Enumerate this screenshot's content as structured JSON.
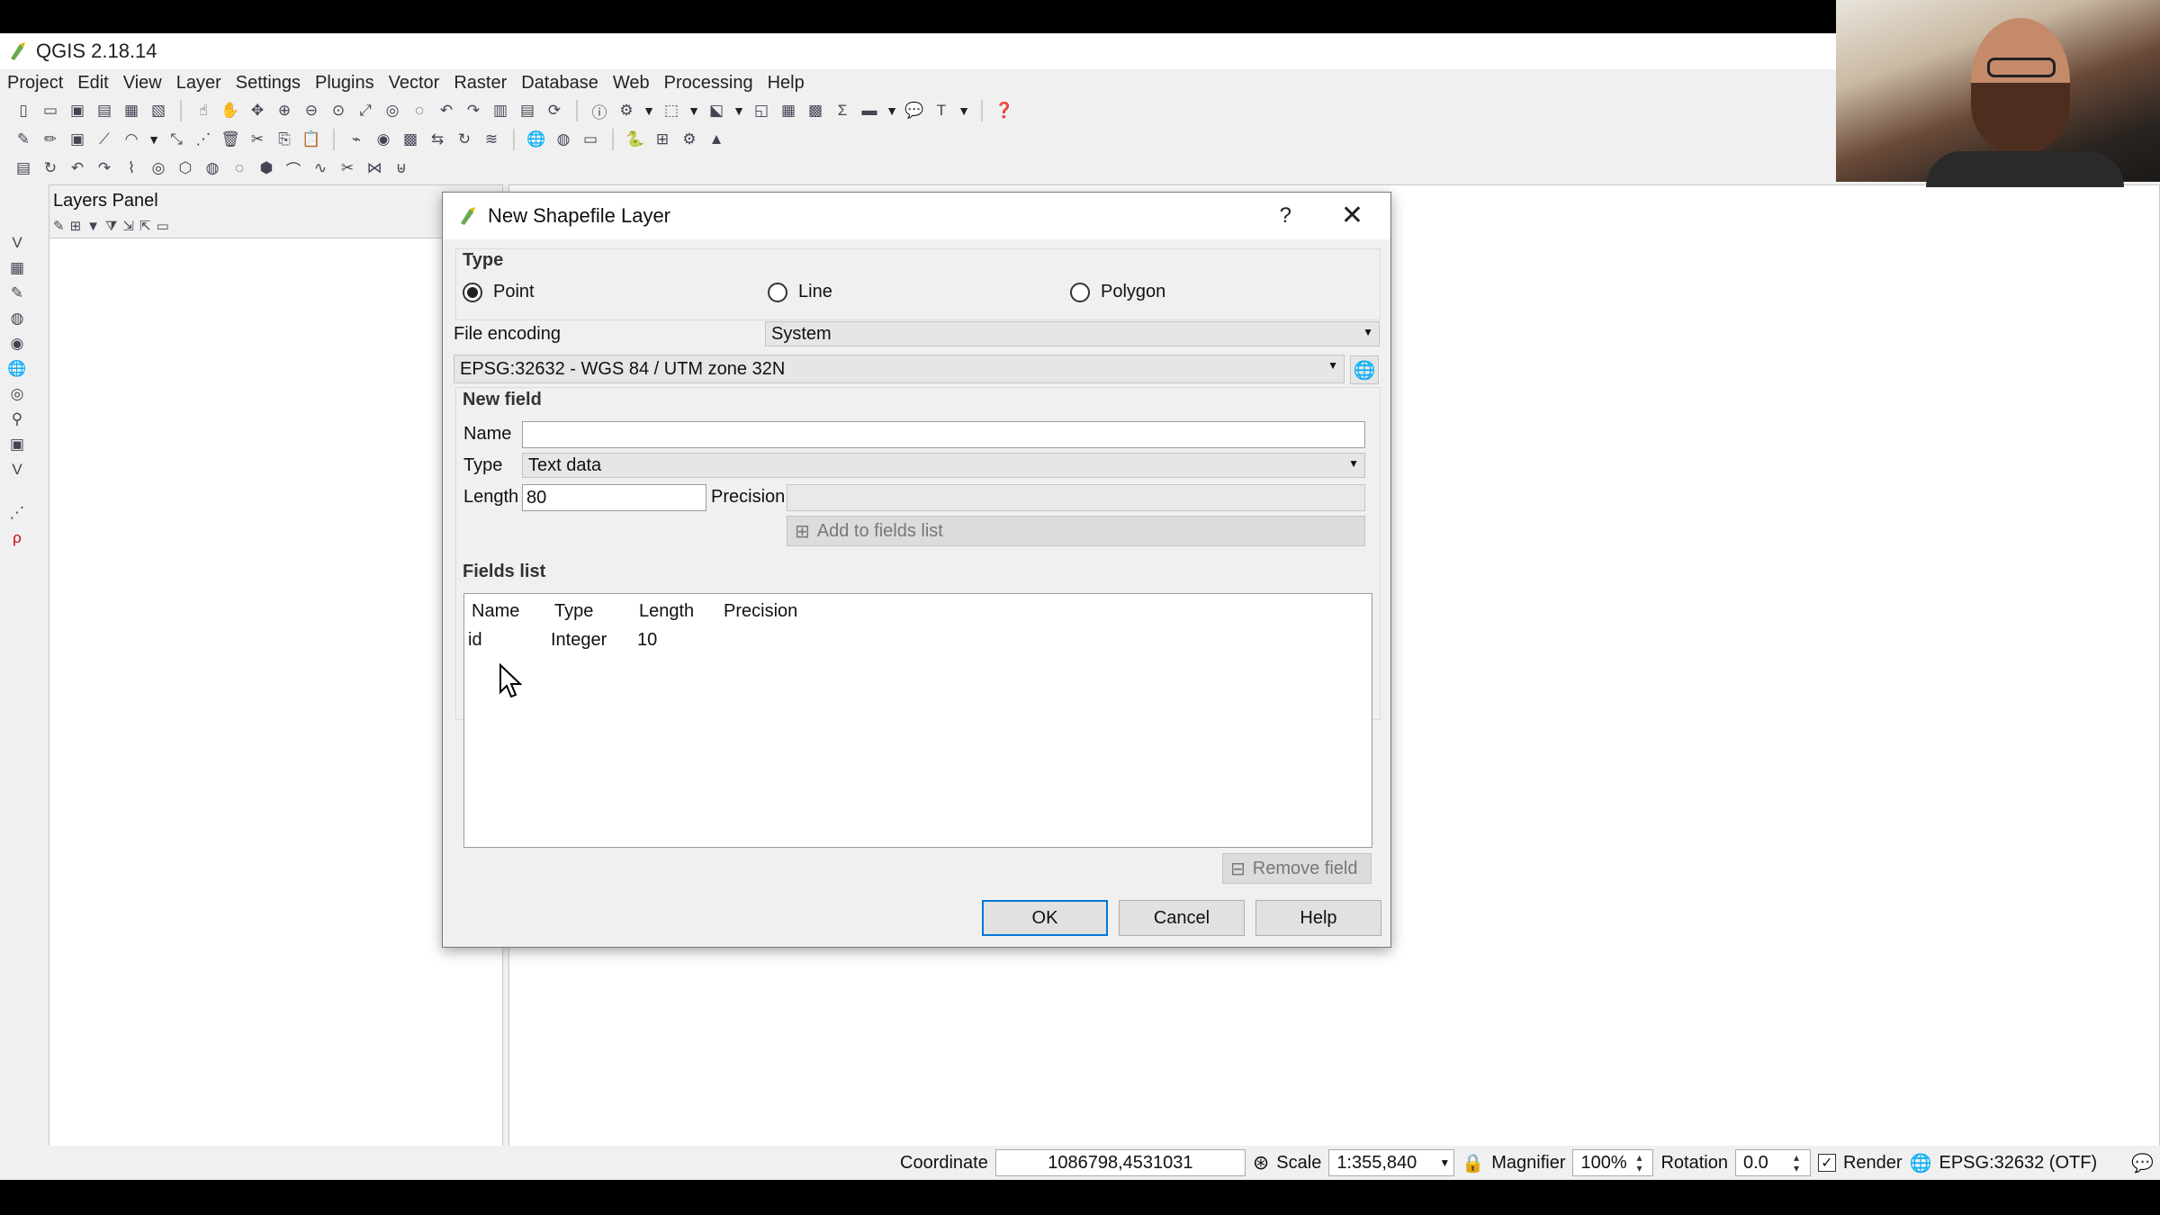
{
  "window": {
    "title": "QGIS 2.18.14"
  },
  "menu": [
    "Project",
    "Edit",
    "View",
    "Layer",
    "Settings",
    "Plugins",
    "Vector",
    "Raster",
    "Database",
    "Web",
    "Processing",
    "Help"
  ],
  "layers_panel": {
    "title": "Layers Panel"
  },
  "dialog": {
    "title": "New Shapefile Layer",
    "help_glyph": "?",
    "close_glyph": "✕",
    "type_group": "Type",
    "geometry_types": [
      {
        "label": "Point",
        "selected": true
      },
      {
        "label": "Line",
        "selected": false
      },
      {
        "label": "Polygon",
        "selected": false
      }
    ],
    "file_encoding_label": "File encoding",
    "file_encoding_value": "System",
    "crs_value": "EPSG:32632 - WGS 84 / UTM zone 32N",
    "new_field": {
      "group": "New field",
      "name_label": "Name",
      "name_value": "",
      "type_label": "Type",
      "type_value": "Text data",
      "length_label": "Length",
      "length_value": "80",
      "precision_label": "Precision",
      "precision_value": "",
      "add_button": "Add to fields list"
    },
    "fields_list": {
      "group": "Fields list",
      "columns": [
        "Name",
        "Type",
        "Length",
        "Precision"
      ],
      "rows": [
        {
          "name": "id",
          "type": "Integer",
          "length": "10",
          "precision": ""
        }
      ],
      "remove_button": "Remove field"
    },
    "buttons": {
      "ok": "OK",
      "cancel": "Cancel",
      "help": "Help"
    }
  },
  "status_bar": {
    "coordinate_label": "Coordinate",
    "coordinate_value": "1086798,4531031",
    "scale_label": "Scale",
    "scale_value": "1:355,840",
    "magnifier_label": "Magnifier",
    "magnifier_value": "100%",
    "rotation_label": "Rotation",
    "rotation_value": "0.0",
    "render_label": "Render",
    "render_checked": true,
    "crs_label": "EPSG:32632 (OTF)"
  },
  "colors": {
    "accent": "#0078d7",
    "qgis_green": "#6aa84f"
  }
}
